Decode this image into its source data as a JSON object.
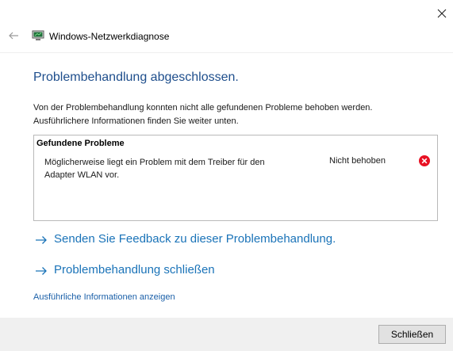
{
  "window": {
    "close_icon": "close-icon",
    "back_icon": "back-arrow-icon",
    "app_icon": "network-diagnostics-icon",
    "title": "Windows-Netzwerkdiagnose"
  },
  "main": {
    "heading": "Problembehandlung abgeschlossen.",
    "description_line1": "Von der Problembehandlung konnten nicht alle gefundenen Probleme behoben werden.",
    "description_line2": "Ausführlichere Informationen finden Sie weiter unten.",
    "problems": {
      "header": "Gefundene Probleme",
      "items": [
        {
          "text_line1": "Möglicherweise liegt ein Problem mit dem Treiber für den",
          "text_line2": "Adapter WLAN vor.",
          "status": "Nicht behoben",
          "status_icon": "error-icon",
          "status_color": "#e81123"
        }
      ]
    },
    "links": {
      "feedback": "Senden Sie Feedback zu dieser Problembehandlung.",
      "close": "Problembehandlung schließen",
      "details": "Ausführliche Informationen anzeigen"
    },
    "accent_color": "#1a73b8",
    "heading_color": "#1e4e8c"
  },
  "footer": {
    "close_button": "Schließen"
  }
}
